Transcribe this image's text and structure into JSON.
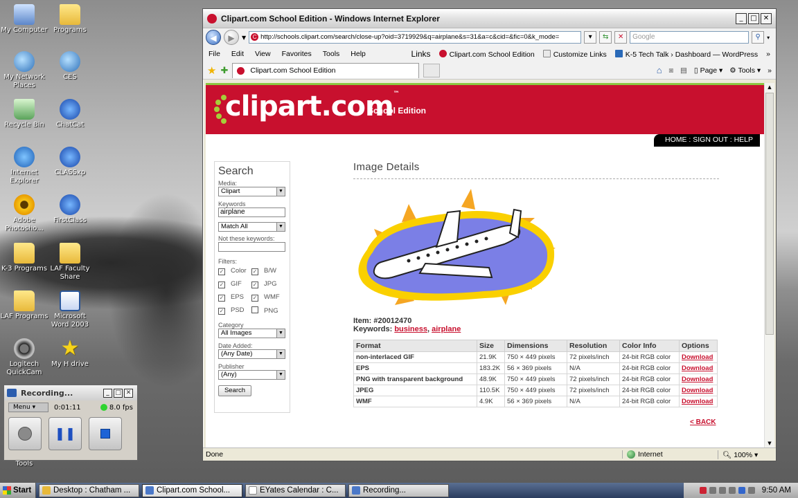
{
  "desktop": {
    "icons": [
      {
        "label": "My Computer",
        "icon": "computer-icon"
      },
      {
        "label": "Programs",
        "icon": "folder-icon"
      },
      {
        "label": "My Network Places",
        "icon": "network-icon"
      },
      {
        "label": "CES",
        "icon": "shortcut-icon"
      },
      {
        "label": "Recycle Bin",
        "icon": "recycle-bin-icon"
      },
      {
        "label": "ChatCat",
        "icon": "shortcut-icon"
      },
      {
        "label": "Internet Explorer",
        "icon": "internet-explorer-icon"
      },
      {
        "label": "CLASSxp",
        "icon": "shortcut-icon"
      },
      {
        "label": "Adobe Photosho...",
        "icon": "photoshop-icon"
      },
      {
        "label": "FirstClass",
        "icon": "shortcut-icon"
      },
      {
        "label": "K-3 Programs",
        "icon": "folder-icon"
      },
      {
        "label": "LAF Faculty Share",
        "icon": "folder-icon"
      },
      {
        "label": "LAF Programs",
        "icon": "folder-icon"
      },
      {
        "label": "Microsoft Word 2003",
        "icon": "word-icon"
      },
      {
        "label": "Logitech QuickCam",
        "icon": "webcam-icon"
      },
      {
        "label": "My H drive",
        "icon": "star-icon"
      },
      {
        "label": "Tools",
        "icon": "folder-icon"
      }
    ]
  },
  "ie": {
    "title": "Clipart.com School Edition - Windows Internet Explorer",
    "address": "http://schools.clipart.com/search/close-up?oid=3719929&q=airplane&s=31&a=c&cid=&fic=0&k_mode=",
    "search_placeholder": "Google",
    "menu": [
      "File",
      "Edit",
      "View",
      "Favorites",
      "Tools",
      "Help"
    ],
    "links_label": "Links",
    "links": [
      "Clipart.com School Edition",
      "Customize Links",
      "K-5 Tech Talk › Dashboard — WordPress"
    ],
    "tab_title": "Clipart.com School Edition",
    "cmd_page": "Page",
    "cmd_tools": "Tools",
    "status_text": "Done",
    "status_zone": "Internet",
    "status_zoom": "100%"
  },
  "clipart": {
    "logo_text": "clipart.com",
    "logo_tm": "™",
    "edition": "School Edition",
    "utility_nav": "HOME : SIGN OUT : HELP",
    "search": {
      "heading": "Search",
      "media_label": "Media:",
      "media_value": "Clipart",
      "keywords_label": "Keywords",
      "keywords_value": "airplane",
      "match_value": "Match All",
      "not_keywords_label": "Not these keywords:",
      "filters_label": "Filters:",
      "filters": [
        {
          "label": "Color",
          "checked": true
        },
        {
          "label": "B/W",
          "checked": true
        },
        {
          "label": "GIF",
          "checked": true
        },
        {
          "label": "JPG",
          "checked": true
        },
        {
          "label": "EPS",
          "checked": true
        },
        {
          "label": "WMF",
          "checked": true
        },
        {
          "label": "PSD",
          "checked": true
        },
        {
          "label": "PNG",
          "checked": false
        }
      ],
      "category_label": "Category",
      "category_value": "All Images",
      "date_label": "Date Added:",
      "date_value": "(Any Date)",
      "publisher_label": "Publisher",
      "publisher_value": "(Any)",
      "button": "Search"
    },
    "details": {
      "heading": "Image Details",
      "item": "Item: #20012470",
      "keywords_label": "Keywords:",
      "keywords": [
        "business",
        "airplane"
      ],
      "columns": [
        "Format",
        "Size",
        "Dimensions",
        "Resolution",
        "Color Info",
        "Options"
      ],
      "rows": [
        [
          "non-interlaced GIF",
          "21.9K",
          "750 × 449 pixels",
          "72 pixels/inch",
          "24-bit RGB color",
          "Download"
        ],
        [
          "EPS",
          "183.2K",
          "56 × 369 pixels",
          "N/A",
          "24-bit RGB color",
          "Download"
        ],
        [
          "PNG with transparent background",
          "48.9K",
          "750 × 449 pixels",
          "72 pixels/inch",
          "24-bit RGB color",
          "Download"
        ],
        [
          "JPEG",
          "110.5K",
          "750 × 449 pixels",
          "72 pixels/inch",
          "24-bit RGB color",
          "Download"
        ],
        [
          "WMF",
          "4.9K",
          "56 × 369 pixels",
          "N/A",
          "24-bit RGB color",
          "Download"
        ]
      ],
      "back": "< BACK"
    }
  },
  "recorder": {
    "title": "Recording...",
    "menu": "Menu",
    "time": "0:01:11",
    "fps": "8.0 fps"
  },
  "taskbar": {
    "start": "Start",
    "tasks": [
      "Desktop : Chatham ...",
      "Clipart.com School...",
      "EYates Calendar : C...",
      "Recording..."
    ],
    "clock": "9:50 AM"
  }
}
